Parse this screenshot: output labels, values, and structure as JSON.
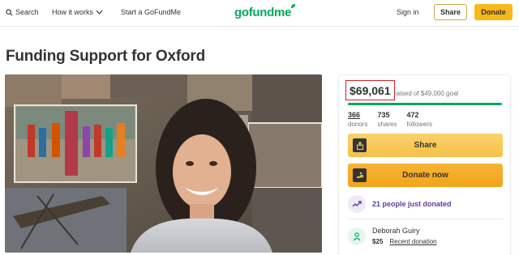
{
  "header": {
    "search_label": "Search",
    "how_it_works_label": "How it works",
    "start_label": "Start a GoFundMe",
    "logo_text": "gofundme",
    "signin_label": "Sign in",
    "share_label": "Share",
    "donate_label": "Donate"
  },
  "page": {
    "title": "Funding Support for Oxford"
  },
  "campaign": {
    "raised_amount": "$69,061",
    "raised_text": "raised of $49,000 goal",
    "progress_fraction": 1.0,
    "stats": [
      {
        "value": "366",
        "label": "donors"
      },
      {
        "value": "735",
        "label": "shares"
      },
      {
        "value": "472",
        "label": "followers"
      }
    ],
    "share_button": "Share",
    "donate_button": "Donate now",
    "recent_activity": "21 people just donated",
    "donor": {
      "name": "Deborah Guiry",
      "amount": "$25",
      "tag": "Recent donation"
    }
  },
  "colors": {
    "brand_green": "#02a95c",
    "button_yellow": "#f9b81a",
    "highlight_red": "#d4202a",
    "activity_purple": "#5a3ea3"
  }
}
